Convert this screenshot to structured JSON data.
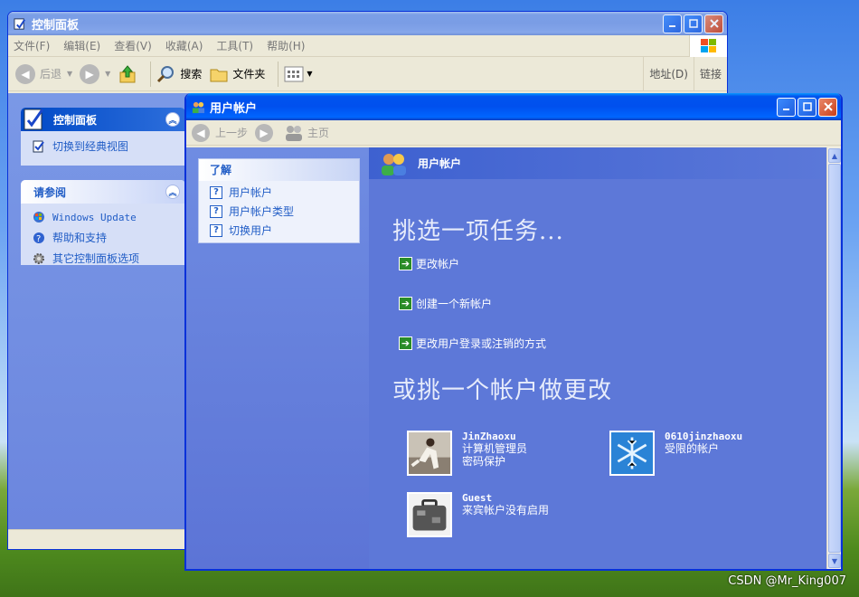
{
  "control_panel": {
    "title": "控制面板",
    "menu": [
      "文件(F)",
      "编辑(E)",
      "查看(V)",
      "收藏(A)",
      "工具(T)",
      "帮助(H)"
    ],
    "back": "后退",
    "search": "搜索",
    "folders": "文件夹",
    "address": "地址(D)",
    "links": "链接",
    "panel_title": "控制面板",
    "switch_classic": "切换到经典视图",
    "see_also": "请参阅",
    "see_also_items": [
      "Windows Update",
      "帮助和支持",
      "其它控制面板选项"
    ]
  },
  "user_accounts": {
    "title": "用户帐户",
    "back": "上一步",
    "home": "主页",
    "learn_title": "了解",
    "learn_items": [
      "用户帐户",
      "用户帐户类型",
      "切换用户"
    ],
    "header": "用户帐户",
    "pick_task": "挑选一项任务...",
    "tasks": [
      "更改帐户",
      "创建一个新帐户",
      "更改用户登录或注销的方式"
    ],
    "pick_account": "或挑一个帐户做更改",
    "accounts": [
      {
        "name": "JinZhaoxu",
        "line1": "计算机管理员",
        "line2": "密码保护"
      },
      {
        "name": "0610jinzhaoxu",
        "line1": "受限的帐户",
        "line2": ""
      },
      {
        "name": "Guest",
        "line1": "来宾帐户没有启用",
        "line2": ""
      }
    ]
  },
  "watermark": "CSDN @Mr_King007"
}
